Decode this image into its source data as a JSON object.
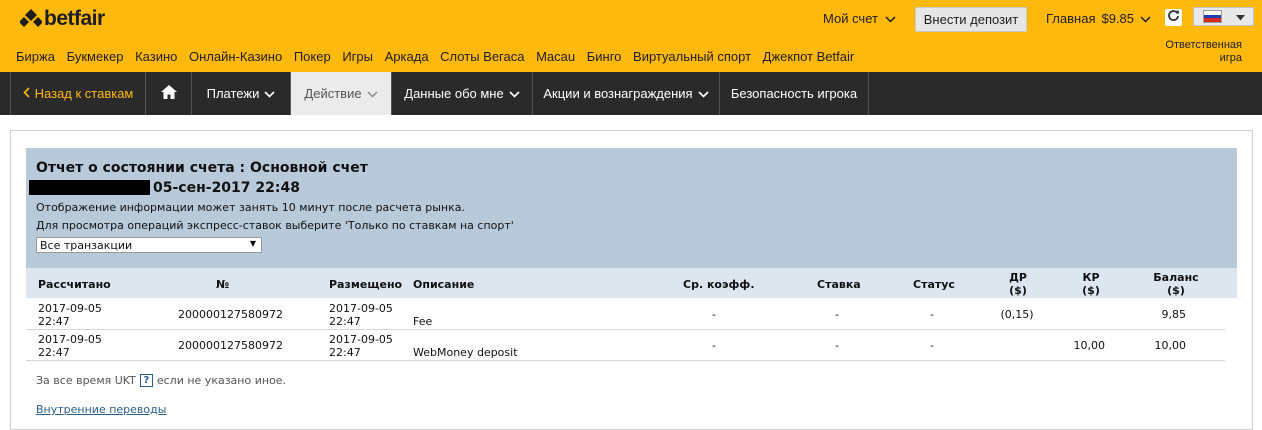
{
  "brand": {
    "name": "betfair"
  },
  "header": {
    "account_label": "Мой счет",
    "deposit_label": "Внести депозит",
    "main_label": "Главная",
    "balance": "$9.85",
    "responsible_line1": "Ответственная",
    "responsible_line2": "игра"
  },
  "nav_items": [
    "Биржа",
    "Букмекер",
    "Казино",
    "Онлайн-Казино",
    "Покер",
    "Игры",
    "Аркада",
    "Слоты Вегаса",
    "Macau",
    "Бинго",
    "Виртуальный спорт",
    "Джекпот Betfair"
  ],
  "subnav": {
    "back": "Назад к ставкам",
    "payments": "Платежи",
    "activity": "Действие",
    "my_data": "Данные обо мне",
    "promotions": "Акции и вознаграждения",
    "security": "Безопасность игрока"
  },
  "report": {
    "title": "Отчет о состоянии счета : Основной счет",
    "datetime": "05-сен-2017 22:48",
    "info1": "Отображение информации может занять 10 минут после расчета рынка.",
    "info2": "Для просмотра операций экспресс-ставок выберите 'Только по ставкам на спорт'",
    "filter_value": "Все транзакции"
  },
  "table": {
    "headers": {
      "settled": "Рассчитано",
      "number": "№",
      "placed": "Размещено",
      "description": "Описание",
      "avg_odds": "Ср. коэфф.",
      "stake": "Ставка",
      "status": "Статус",
      "dr": "ДР",
      "dr_unit": "($)",
      "cr": "КР",
      "cr_unit": "($)",
      "balance": "Баланс",
      "balance_unit": "($)"
    },
    "rows": [
      {
        "settled_date": "2017-09-05",
        "settled_time": "22:47",
        "number": "200000127580972",
        "placed_date": "2017-09-05",
        "placed_time": "22:47",
        "description": "Fee",
        "avg_odds": "-",
        "stake": "-",
        "status": "-",
        "dr": "(0,15)",
        "cr": "",
        "balance": "9,85"
      },
      {
        "settled_date": "2017-09-05",
        "settled_time": "22:47",
        "number": "200000127580972",
        "placed_date": "2017-09-05",
        "placed_time": "22:47",
        "description": "WebMoney deposit",
        "avg_odds": "-",
        "stake": "-",
        "status": "-",
        "dr": "",
        "cr": "10,00",
        "balance": "10,00"
      }
    ]
  },
  "footer": {
    "timezone_note_pre": "За все время UKT",
    "help_glyph": "?",
    "timezone_note_post": "если не указано иное.",
    "internal_transfers": "Внутренние переводы"
  },
  "colors": {
    "brand_yellow": "#ffb80c",
    "dark_nav": "#2a2a2a",
    "panel_blue": "#b8c9d9",
    "link_blue": "#2a5d8f"
  }
}
